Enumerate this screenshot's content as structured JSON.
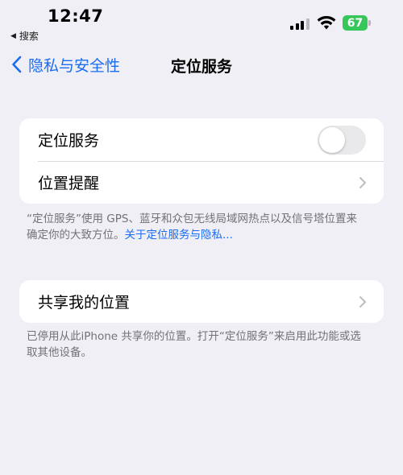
{
  "status_bar": {
    "time": "12:47",
    "back_app": "搜索",
    "battery": "67",
    "colors": {
      "battery": "#35c759"
    },
    "icons": [
      "cellular-signal-icon",
      "wifi-icon",
      "battery-icon"
    ]
  },
  "nav": {
    "back_label": "隐私与安全性",
    "title": "定位服务",
    "accent": "#1a6cf2"
  },
  "location_group": {
    "location_services": {
      "label": "定位服务",
      "toggle_on": false
    },
    "location_alerts": {
      "label": "位置提醒"
    }
  },
  "footnote1": {
    "text": "“定位服务”使用 GPS、蓝牙和众包无线局域网热点以及信号塔位置来确定你的大致方位。",
    "link": "关于定位服务与隐私..."
  },
  "share_group": {
    "share_my_location": {
      "label": "共享我的位置"
    }
  },
  "footnote2": {
    "text": "已停用从此iPhone 共享你的位置。打开“定位服务”来启用此功能或选取其他设备。"
  }
}
